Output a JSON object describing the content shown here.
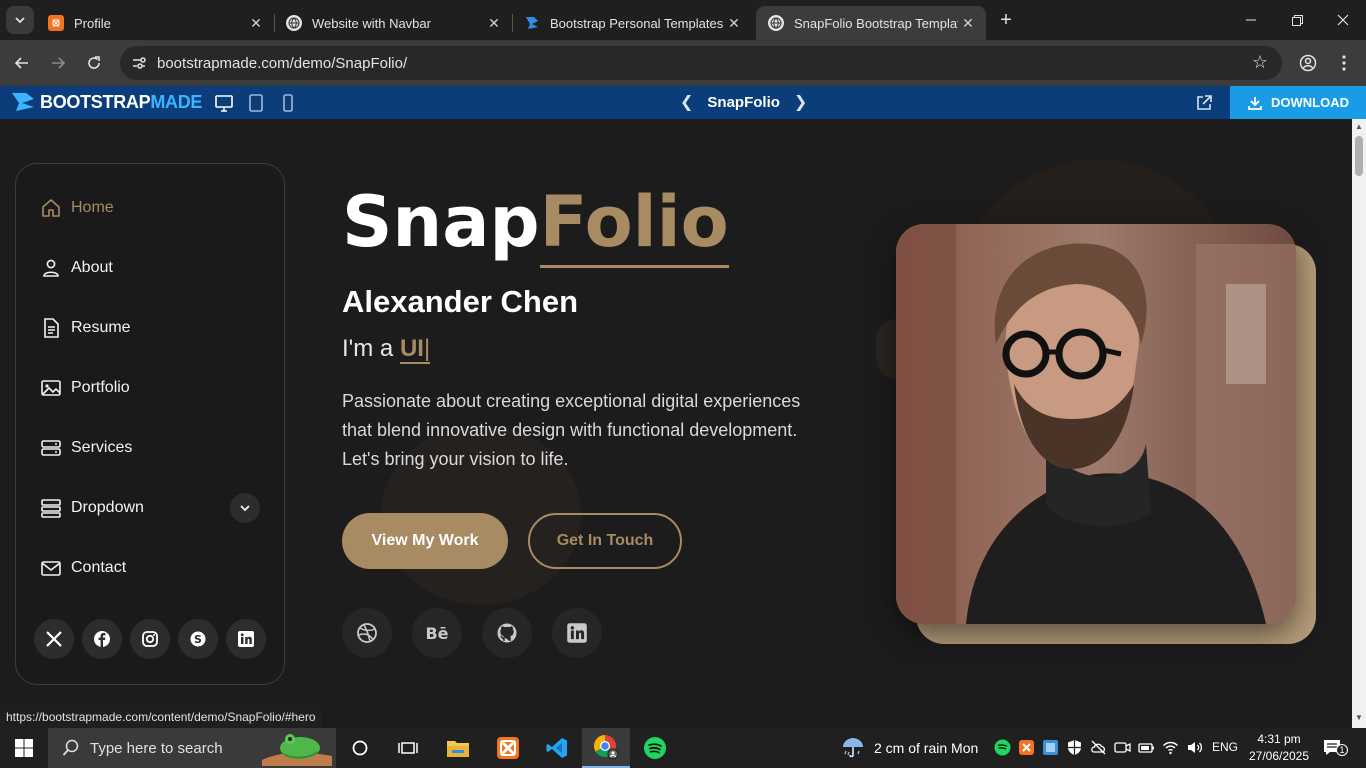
{
  "browser": {
    "tabs": [
      {
        "title": "Profile",
        "active": false
      },
      {
        "title": "Website with Navbar",
        "active": false
      },
      {
        "title": "Bootstrap Personal Templates | B",
        "active": false
      },
      {
        "title": "SnapFolio Bootstrap Template D",
        "active": true
      }
    ],
    "url": "bootstrapmade.com/demo/SnapFolio/",
    "status_url": "https://bootstrapmade.com/content/demo/SnapFolio/#hero"
  },
  "bmbar": {
    "logo_bootstrap": "BOOTSTRAP",
    "logo_made": "MADE",
    "template_name": "SnapFolio",
    "download_label": "DOWNLOAD"
  },
  "sidebar": {
    "items": [
      {
        "label": "Home",
        "icon": "house-icon",
        "active": true
      },
      {
        "label": "About",
        "icon": "person-icon"
      },
      {
        "label": "Resume",
        "icon": "file-text-icon"
      },
      {
        "label": "Portfolio",
        "icon": "images-icon"
      },
      {
        "label": "Services",
        "icon": "hdd-stack-icon"
      },
      {
        "label": "Dropdown",
        "icon": "menu-icon"
      },
      {
        "label": "Contact",
        "icon": "envelope-icon"
      }
    ],
    "social": [
      "x-icon",
      "facebook-icon",
      "instagram-icon",
      "skype-icon",
      "linkedin-icon"
    ]
  },
  "hero": {
    "title_part1": "Snap",
    "title_part2": "Folio",
    "name": "Alexander Chen",
    "typed_prefix": "I'm a ",
    "typed_word": "UI",
    "typed_cursor": "|",
    "description": "Passionate about creating exceptional digital experiences that blend innovative design with functional development. Let's bring your vision to life.",
    "primary_button": "View My Work",
    "secondary_button": "Get In Touch",
    "social": [
      "dribbble-icon",
      "behance-icon",
      "github-icon",
      "linkedin-icon"
    ],
    "behance_text": "Bē",
    "accent_color": "#a88a63"
  },
  "taskbar": {
    "search_placeholder": "Type here to search",
    "weather": "2 cm of rain Mon",
    "language": "ENG",
    "time": "4:31 pm",
    "date": "27/06/2025",
    "notification_count": "1"
  }
}
